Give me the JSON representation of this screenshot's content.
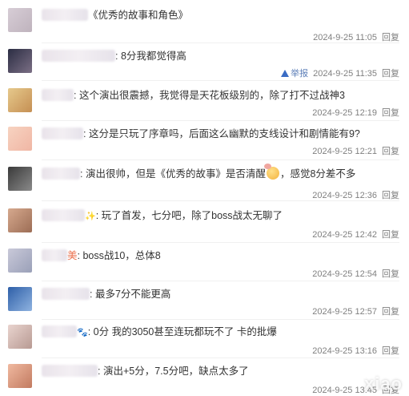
{
  "comments": [
    {
      "text": "《优秀的故事和角色》",
      "time": "2024-9-25 11:05",
      "reply": "回复"
    },
    {
      "text": ": 8分我都觉得高",
      "time": "2024-9-25 11:35",
      "reply": "回复",
      "report": "举报"
    },
    {
      "text": ": 这个演出很震撼，我觉得是天花板级别的，除了打不过战神3",
      "time": "2024-9-25 12:19",
      "reply": "回复"
    },
    {
      "text": ": 这分是只玩了序章吗，后面这么幽默的支线设计和剧情能有9?",
      "time": "2024-9-25 12:21",
      "reply": "回复"
    },
    {
      "text_a": ": 演出很帅，但是《优秀的故事》是否清醒",
      "text_b": "，感觉8分差不多",
      "time": "2024-9-25 12:36",
      "reply": "回复"
    },
    {
      "text": ": 玩了首发，七分吧，除了boss战太无聊了",
      "time": "2024-9-25 12:42",
      "reply": "回复"
    },
    {
      "name": "美",
      "text": ": boss战10，总体8",
      "time": "2024-9-25 12:54",
      "reply": "回复"
    },
    {
      "text": ": 最多7分不能更高",
      "time": "2024-9-25 12:57",
      "reply": "回复"
    },
    {
      "text": ": 0分 我的3050甚至连玩都玩不了 卡的批爆",
      "time": "2024-9-25 13:16",
      "reply": "回复"
    },
    {
      "text": ": 演出+5分，7.5分吧，缺点太多了",
      "time": "2024-9-25 13:45",
      "reply": "回复"
    }
  ],
  "watermark": "xiao"
}
